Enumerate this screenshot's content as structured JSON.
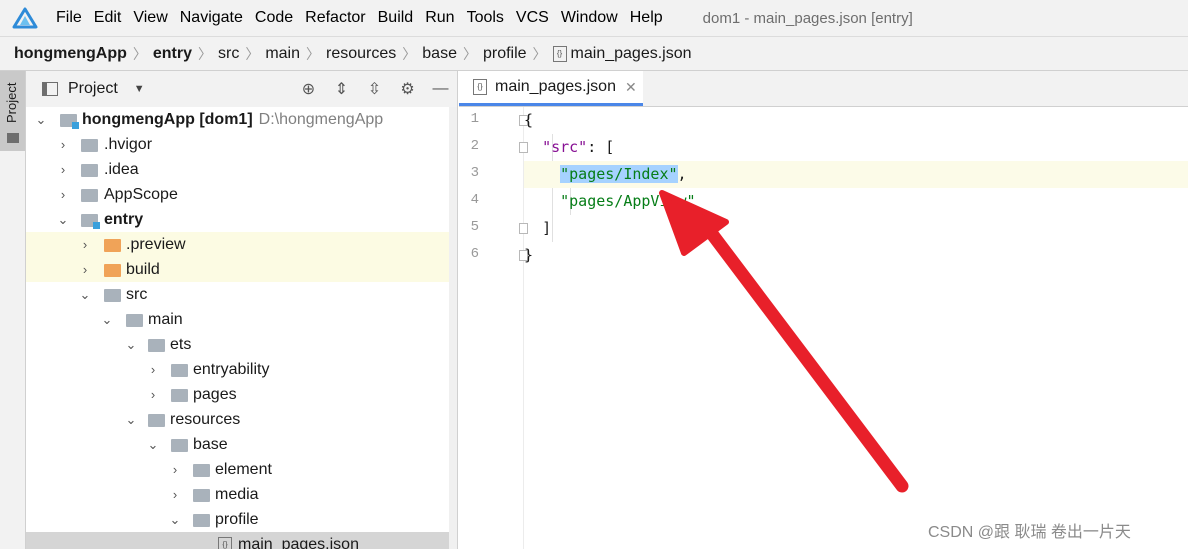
{
  "menubar": {
    "items": [
      "File",
      "Edit",
      "View",
      "Navigate",
      "Code",
      "Refactor",
      "Build",
      "Run",
      "Tools",
      "VCS",
      "Window",
      "Help"
    ],
    "title": "dom1 - main_pages.json [entry]"
  },
  "breadcrumb": {
    "items": [
      "hongmengApp",
      "entry",
      "src",
      "main",
      "resources",
      "base",
      "profile",
      "main_pages.json"
    ]
  },
  "toolstripe": {
    "project_label": "Project"
  },
  "panel": {
    "title": "Project",
    "tree": [
      {
        "name": "hongmengApp [dom1]",
        "path": "D:\\hongmengApp"
      },
      {
        "name": ".hvigor"
      },
      {
        "name": ".idea"
      },
      {
        "name": "AppScope"
      },
      {
        "name": "entry"
      },
      {
        "name": ".preview"
      },
      {
        "name": "build"
      },
      {
        "name": "src"
      },
      {
        "name": "main"
      },
      {
        "name": "ets"
      },
      {
        "name": "entryability"
      },
      {
        "name": "pages"
      },
      {
        "name": "resources"
      },
      {
        "name": "base"
      },
      {
        "name": "element"
      },
      {
        "name": "media"
      },
      {
        "name": "profile"
      },
      {
        "name": "main_pages.json"
      }
    ]
  },
  "editor": {
    "tab_label": "main_pages.json",
    "line_numbers": [
      "1",
      "2",
      "3",
      "4",
      "5",
      "6"
    ],
    "code": {
      "l1_brace": "{",
      "l2_key": "\"src\"",
      "l2_rest": ": [",
      "l3_value": "\"pages/Index\"",
      "l3_comma": ",",
      "l4_value": "\"pages/AppView\"",
      "l5_bracket": "]",
      "l6_brace": "}"
    }
  },
  "watermark": "CSDN @跟 耿瑞 卷出一片天",
  "colors": {
    "annotation_arrow": "#e8202a",
    "selection": "#a6d2ff",
    "accent": "#4a86e8"
  }
}
